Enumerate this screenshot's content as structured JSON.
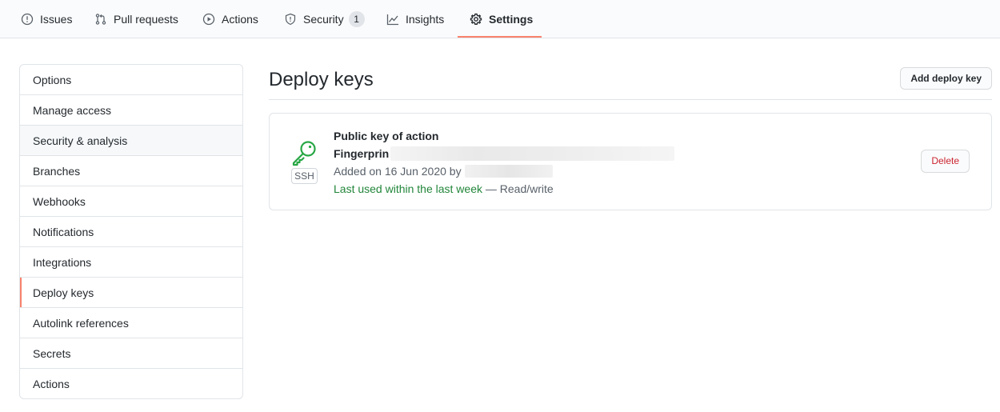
{
  "tabs": [
    {
      "label": "Issues",
      "icon": "issue-opened-icon"
    },
    {
      "label": "Pull requests",
      "icon": "git-pull-request-icon"
    },
    {
      "label": "Actions",
      "icon": "play-icon"
    },
    {
      "label": "Security",
      "icon": "shield-icon",
      "counter": "1"
    },
    {
      "label": "Insights",
      "icon": "graph-icon"
    },
    {
      "label": "Settings",
      "icon": "gear-icon",
      "selected": true
    }
  ],
  "colors": {
    "accent_underline": "#f9826c",
    "key_icon": "#28a745",
    "danger_text": "#cb2431",
    "recent_text": "#22863a"
  },
  "sidebar": {
    "items": [
      {
        "label": "Options"
      },
      {
        "label": "Manage access"
      },
      {
        "label": "Security & analysis"
      },
      {
        "label": "Branches"
      },
      {
        "label": "Webhooks"
      },
      {
        "label": "Notifications"
      },
      {
        "label": "Integrations"
      },
      {
        "label": "Deploy keys",
        "selected": true
      },
      {
        "label": "Autolink references"
      },
      {
        "label": "Secrets"
      },
      {
        "label": "Actions"
      }
    ]
  },
  "main": {
    "title": "Deploy keys",
    "add_button": "Add deploy key",
    "key": {
      "title": "Public key of action",
      "fingerprint_label": "Fingerprin",
      "added_text": "Added on 16 Jun 2020 by",
      "last_used": "Last used within the last week",
      "access": " — Read/write",
      "type_label": "SSH",
      "delete_button": "Delete"
    }
  }
}
